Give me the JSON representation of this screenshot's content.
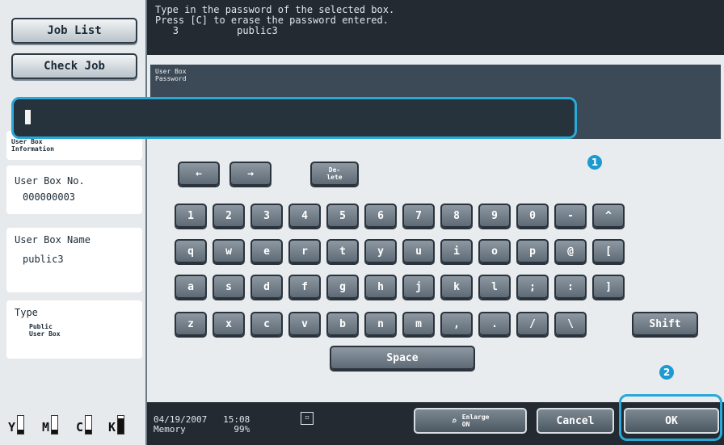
{
  "sidebar": {
    "job_list": "Job List",
    "check_job": "Check Job",
    "info_heading": "User Box\nInformation",
    "box_no_label": "User Box No.",
    "box_no_value": "000000003",
    "box_name_label": "User Box Name",
    "box_name_value": "public3",
    "type_label": "Type",
    "type_value": "Public\nUser Box",
    "toners": [
      {
        "label": "Y",
        "level": 0.25
      },
      {
        "label": "M",
        "level": 0.25
      },
      {
        "label": "C",
        "level": 0.25
      },
      {
        "label": "K",
        "level": 0.85
      }
    ]
  },
  "message": {
    "line1": "Type in the password of the selected box.",
    "line2": "Press [C] to erase the password entered.",
    "line3_num": "3",
    "line3_name": "public3"
  },
  "field": {
    "caption": "User Box\nPassword",
    "value": ""
  },
  "markers": {
    "one": "1",
    "two": "2"
  },
  "keyboard": {
    "left_arrow": "←",
    "right_arrow": "→",
    "delete": "De-\nlete",
    "row1": [
      "1",
      "2",
      "3",
      "4",
      "5",
      "6",
      "7",
      "8",
      "9",
      "0",
      "-",
      "^"
    ],
    "row2": [
      "q",
      "w",
      "e",
      "r",
      "t",
      "y",
      "u",
      "i",
      "o",
      "p",
      "@",
      "["
    ],
    "row3": [
      "a",
      "s",
      "d",
      "f",
      "g",
      "h",
      "j",
      "k",
      "l",
      ";",
      ":",
      "]"
    ],
    "row4": [
      "z",
      "x",
      "c",
      "v",
      "b",
      "n",
      "m",
      ",",
      ".",
      "/",
      "\\"
    ],
    "shift": "Shift",
    "space": "Space"
  },
  "footer": {
    "date": "04/19/2007",
    "time": "15:08",
    "memory_label": "Memory",
    "memory_value": "99%",
    "enlarge": "Enlarge\nON",
    "cancel": "Cancel",
    "ok": "OK"
  }
}
